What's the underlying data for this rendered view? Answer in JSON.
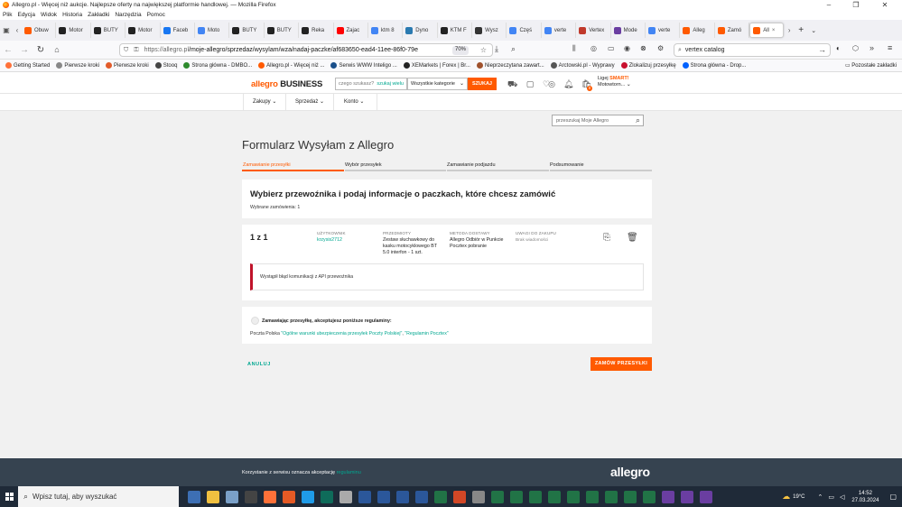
{
  "window": {
    "title": "Allegro.pl - Więcej niż aukcje. Najlepsze oferty na największej platformie handlowej. — Mozilla Firefox",
    "controls": [
      "–",
      "❐",
      "✕"
    ]
  },
  "menu": [
    "Plik",
    "Edycja",
    "Widok",
    "Historia",
    "Zakładki",
    "Narzędzia",
    "Pomoc"
  ],
  "tabs": [
    {
      "label": "Obuw",
      "color": "#ff5a00"
    },
    {
      "label": "Motor",
      "color": "#222222"
    },
    {
      "label": "BUTY",
      "color": "#222222"
    },
    {
      "label": "Motor",
      "color": "#222222"
    },
    {
      "label": "Faceb",
      "color": "#1877f2"
    },
    {
      "label": "Moto",
      "color": "#4285f4"
    },
    {
      "label": "BUTY",
      "color": "#222222"
    },
    {
      "label": "BUTY",
      "color": "#222222"
    },
    {
      "label": "Reka",
      "color": "#222222"
    },
    {
      "label": "Zajac",
      "color": "#ff0000"
    },
    {
      "label": "ktm 8",
      "color": "#4285f4"
    },
    {
      "label": "Dyno",
      "color": "#2a7ab0"
    },
    {
      "label": "KTM F",
      "color": "#222222"
    },
    {
      "label": "Wysz",
      "color": "#333333"
    },
    {
      "label": "Częś",
      "color": "#4285f4"
    },
    {
      "label": "verte",
      "color": "#4285f4"
    },
    {
      "label": "Vertex",
      "color": "#c0392b"
    },
    {
      "label": "Mode",
      "color": "#6a3ea1"
    },
    {
      "label": "verte",
      "color": "#4285f4"
    },
    {
      "label": "Alleg",
      "color": "#ff5a00"
    },
    {
      "label": "Zamó",
      "color": "#ff5a00"
    },
    {
      "label": "All",
      "color": "#ff5a00",
      "active": true
    }
  ],
  "nav": {
    "url_host": "https://allegro.pl",
    "url_path": "/moje-allegro/sprzedaz/wysylam/wza/nadaj-paczke/af683650-ead4-11ee-86f0-79e",
    "zoom": "70%",
    "search_value": "vertex catalog"
  },
  "bookmarks": [
    {
      "label": "Getting Started",
      "color": "#ff7139"
    },
    {
      "label": "Pierwsze kroki",
      "color": "#888888"
    },
    {
      "label": "Pierwsze kroki",
      "color": "#e25b2a"
    },
    {
      "label": "Stooq",
      "color": "#444444"
    },
    {
      "label": "Strona główna - DMBO...",
      "color": "#2d8a2d"
    },
    {
      "label": "Allegro.pl - Więcej niż ...",
      "color": "#ff5a00"
    },
    {
      "label": "Serwis WWW Inteligo ...",
      "color": "#1a4f8a"
    },
    {
      "label": "XEMarkets | Forex | Br...",
      "color": "#222222"
    },
    {
      "label": "Nieprzeczytana zawart...",
      "color": "#a0522d"
    },
    {
      "label": "Arctowski.pl - Wyprawy",
      "color": "#555555"
    },
    {
      "label": "Zlokalizuj przesyłkę",
      "color": "#c8102e"
    },
    {
      "label": "Strona główna - Drop...",
      "color": "#0061fe"
    }
  ],
  "bookmarks_other": "Pozostałe zakładki",
  "allegro_header": {
    "logo_main": "allegro",
    "logo_business": "BUSINESS",
    "search_placeholder": "czego szukasz?",
    "search_many": "szukaj wielu",
    "category": "Wszystkie kategorie",
    "search_button": "SZUKAJ",
    "smart_prefix": "Ligej",
    "smart_label": "SMART!",
    "username": "Motowtorn...",
    "cart_badge": "0"
  },
  "subnav": [
    "Zakupy",
    "Sprzedaż",
    "Konto"
  ],
  "moje_search_placeholder": "przeszukaj Moje Allegro",
  "page_title": "Formularz Wysyłam z Allegro",
  "steps": [
    {
      "label": "Zamawianie przesyłki",
      "active": true
    },
    {
      "label": "Wybór przesyłek",
      "active": false
    },
    {
      "label": "Zamawianie podjazdu",
      "active": false
    },
    {
      "label": "Podsumowanie",
      "active": false
    }
  ],
  "section1": {
    "heading": "Wybierz przewoźnika i podaj informacje o paczkach, które chcesz zamówić",
    "selected_orders": "Wybrane zamówienia: 1"
  },
  "order": {
    "counter": "1 z 1",
    "user_label": "UŻYTKOWNIK",
    "user_value": "krzysis2712",
    "items_label": "PRZEDMIOTY",
    "items_value_1": "Zestaw słuchawkowy do",
    "items_value_2": "kasku motocyklowego BT",
    "items_value_3": "5.0 interfon - 1 szt.",
    "delivery_label": "METODA DOSTAWY",
    "delivery_value_1": "Allegro Odbiór w Punkcie",
    "delivery_value_2": "Pocztex pobranie",
    "notes_label": "UWAGI DO ZAKUPU",
    "notes_value": "Brak wiadomości"
  },
  "error_message": "Wystąpił błąd komunikacji z API przewoźnika",
  "terms": {
    "heading": "Zamawiając przesyłkę, akceptujesz poniższe regulaminy:",
    "carrier": "Poczta Polska",
    "link1": "\"Ogólne warunki ubezpieczenia przesyłek Poczty Polskiej\"",
    "sep": ",",
    "link2": "\"Regulamin Pocztex\""
  },
  "buttons": {
    "cancel": "ANULUJ",
    "order": "ZAMÓW PRZESYŁKI"
  },
  "footer": {
    "text": "Korzystanie z serwisu oznacza akceptację",
    "link": "regulaminu",
    "logo": "allegro"
  },
  "taskbar": {
    "search_placeholder": "Wpisz tutaj, aby wyszukać",
    "temperature": "19°C",
    "time": "14:52",
    "date": "27.03.2024",
    "apps": [
      "#3d6fb4",
      "#f0c040",
      "#7aa0c8",
      "#444444",
      "#ff7139",
      "#e45a25",
      "#1f9be8",
      "#0f6b5a",
      "#aaaaaa",
      "#2b579a",
      "#2b579a",
      "#2b579a",
      "#2b579a",
      "#217346",
      "#d24726",
      "#888888",
      "#217346",
      "#217346",
      "#217346",
      "#217346",
      "#217346",
      "#217346",
      "#217346",
      "#217346",
      "#217346",
      "#6a3ea1",
      "#6a3ea1",
      "#6a3ea1"
    ]
  }
}
